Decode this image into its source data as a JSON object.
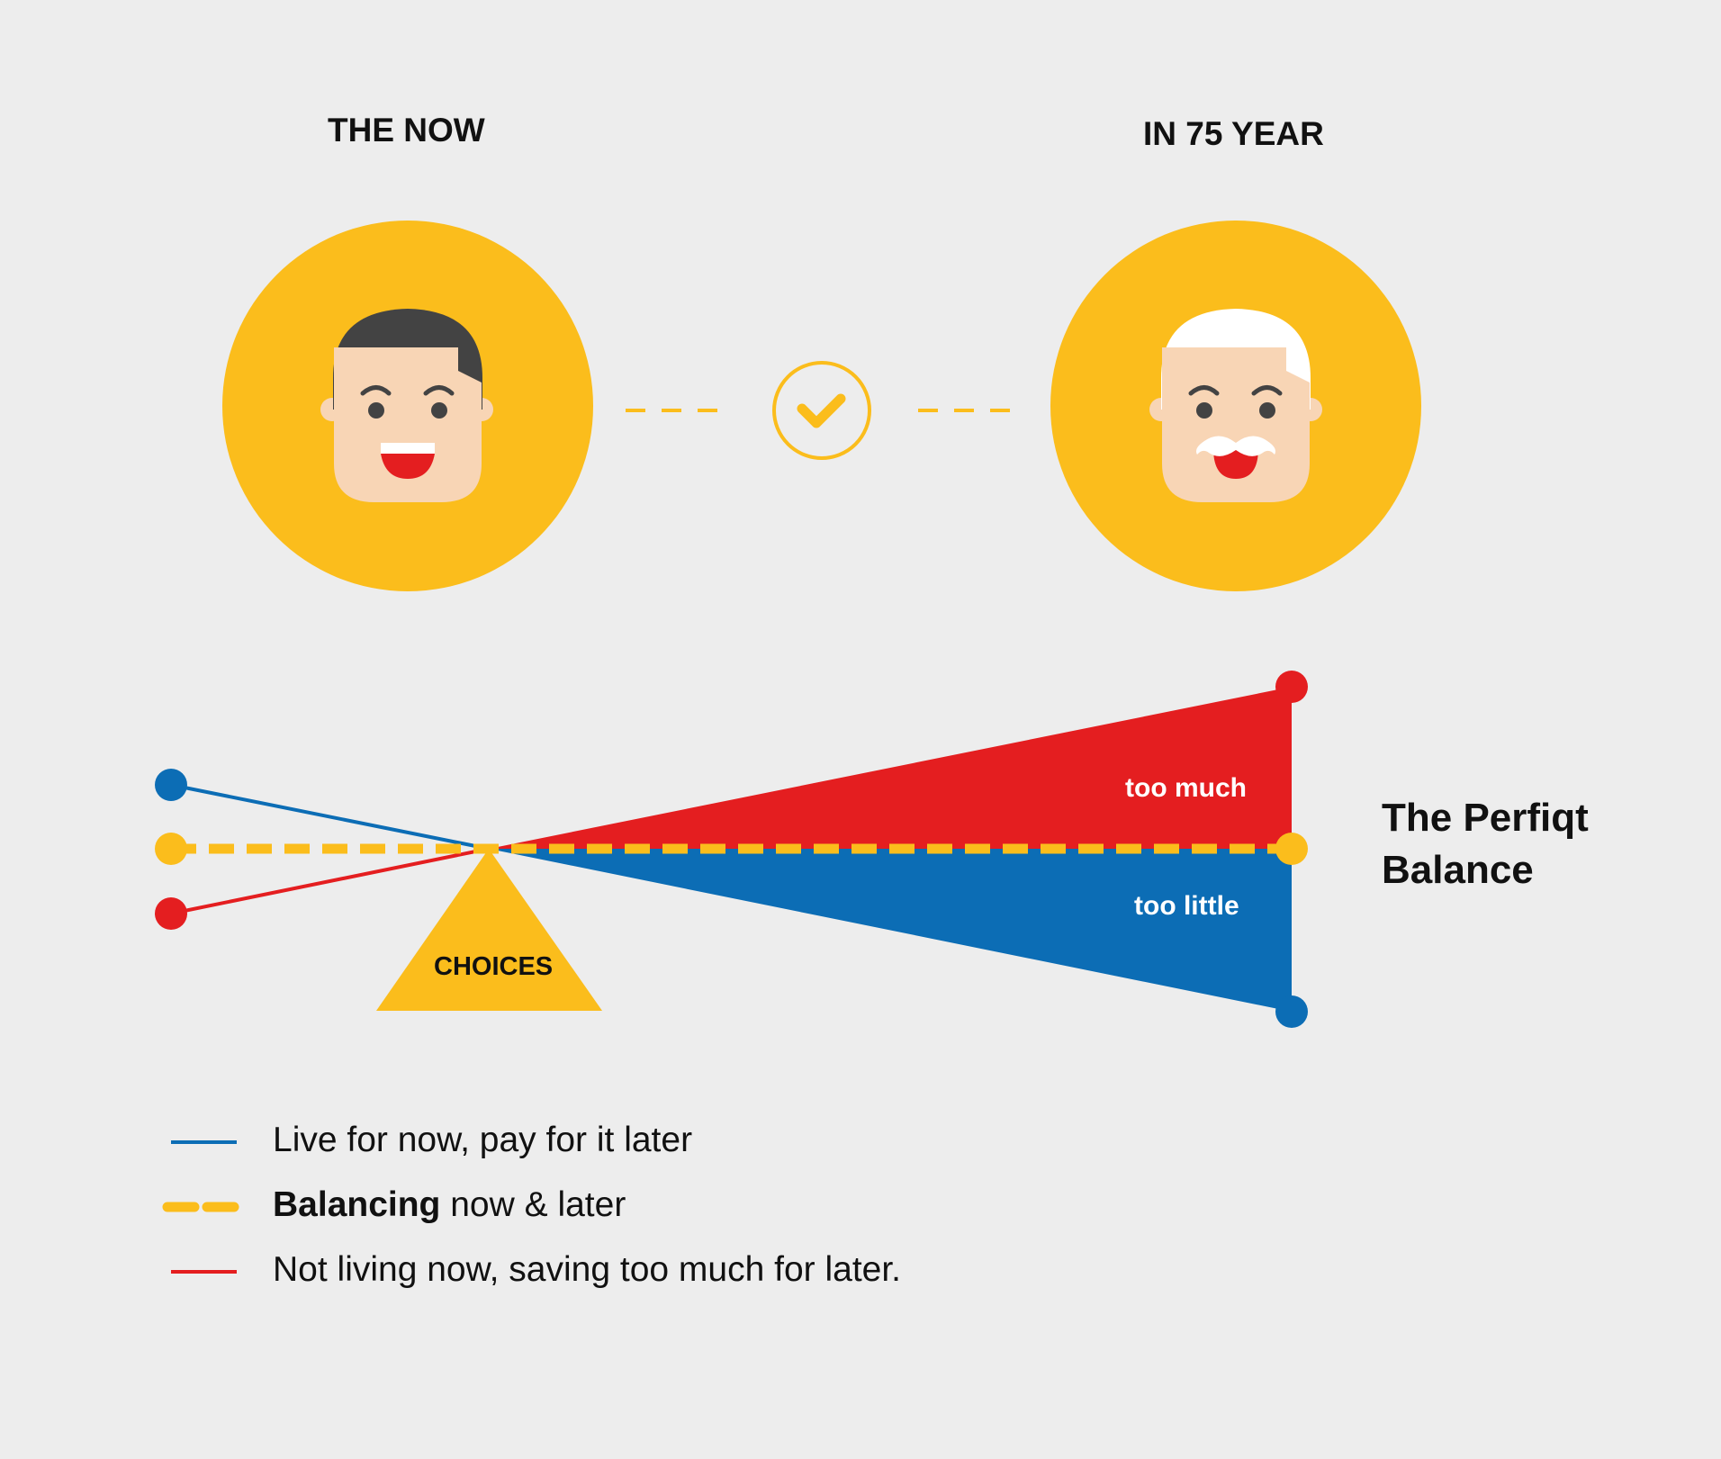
{
  "headers": {
    "now": "THE NOW",
    "future": "IN 75 YEAR"
  },
  "seesaw": {
    "fulcrum_label": "CHOICES",
    "upper_label": "too much",
    "lower_label": "too little",
    "result_line1": "The Perfiqt",
    "result_line2": "Balance"
  },
  "legend": [
    {
      "style": "solid-blue",
      "bold": "",
      "text": "Live for now, pay for it later"
    },
    {
      "style": "dashed-yellow",
      "bold": "Balancing",
      "text": " now & later"
    },
    {
      "style": "solid-red",
      "bold": "",
      "text": "Not living now, saving too much for later."
    }
  ],
  "colors": {
    "yellow": "#fbbd1c",
    "red": "#e41e20",
    "blue": "#0c6db5",
    "background": "#ededed",
    "skin": "#f8d5b5",
    "hair_young": "#434343",
    "hair_old": "#ffffff"
  },
  "icons": [
    "face-young-icon",
    "face-old-icon",
    "check-circle-icon"
  ]
}
